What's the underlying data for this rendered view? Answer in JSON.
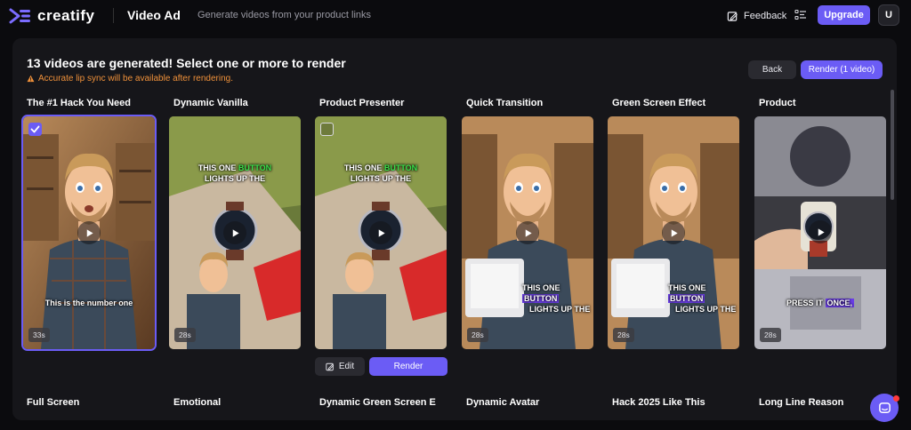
{
  "app": {
    "brand": "creatify",
    "title": "Video Ad",
    "subtitle": "Generate videos from your product links"
  },
  "header": {
    "feedback_label": "Feedback",
    "upgrade_label": "Upgrade",
    "avatar_initial": "U"
  },
  "panel": {
    "heading": "13 videos are generated! Select one or more to render",
    "warning": "Accurate lip sync will be available after rendering.",
    "back_label": "Back",
    "render_label": "Render (1 video)"
  },
  "cards": [
    {
      "title": "The #1 Hack You Need",
      "duration": "33s",
      "caption": "This is the number one",
      "selected": true
    },
    {
      "title": "Dynamic Vanilla",
      "duration": "28s",
      "caption_a": "THIS ONE ",
      "caption_hl": "BUTTON",
      "caption_b": "LIGHTS UP THE"
    },
    {
      "title": "Product Presenter",
      "caption_a": "THIS ONE ",
      "caption_hl": "BUTTON",
      "caption_b": "LIGHTS UP THE",
      "selected": false
    },
    {
      "title": "Quick Transition",
      "duration": "28s",
      "caption_a": "THIS ONE ",
      "caption_hl": "BUTTON",
      "caption_b": "LIGHTS UP THE"
    },
    {
      "title": "Green Screen Effect",
      "duration": "28s",
      "caption_a": "THIS ONE ",
      "caption_hl": "BUTTON",
      "caption_b": "LIGHTS UP THE"
    },
    {
      "title": "Product",
      "duration": "28s",
      "caption_a": "PRESS IT ",
      "caption_hl": "ONCE,"
    }
  ],
  "card_actions": {
    "edit_label": "Edit",
    "render_label": "Render"
  },
  "row2_titles": [
    "Full Screen",
    "Emotional",
    "Dynamic Green Screen E",
    "Dynamic Avatar",
    "Hack 2025 Like This",
    "Long Line Reason"
  ],
  "colors": {
    "accent": "#6b5cf5",
    "warning": "#f0913a",
    "panel_bg": "#16161a",
    "page_bg": "#0b0b0e"
  }
}
